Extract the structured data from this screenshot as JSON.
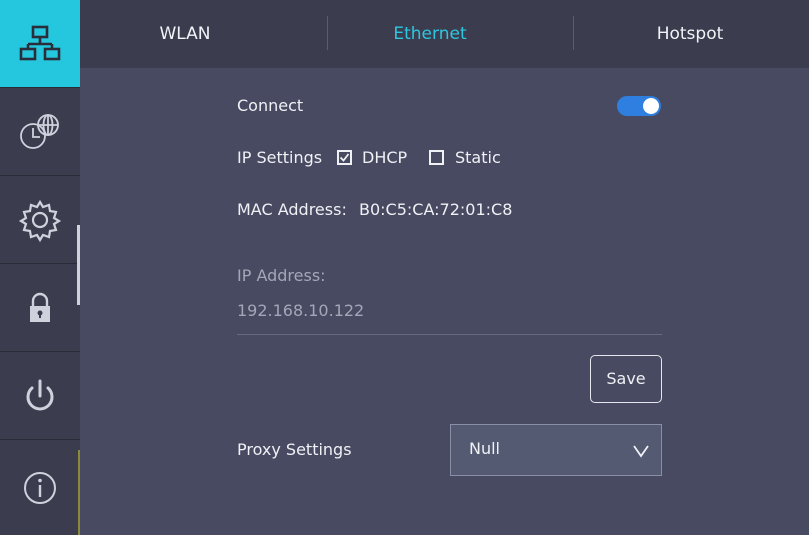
{
  "sidebar": {
    "items": [
      {
        "icon": "network-icon",
        "active": true
      },
      {
        "icon": "time-globe-icon",
        "active": false
      },
      {
        "icon": "gear-icon",
        "active": false
      },
      {
        "icon": "lock-icon",
        "active": false
      },
      {
        "icon": "power-icon",
        "active": false
      },
      {
        "icon": "info-icon",
        "active": false
      }
    ]
  },
  "tabs": [
    {
      "label": "WLAN",
      "active": false
    },
    {
      "label": "Ethernet",
      "active": true
    },
    {
      "label": "Hotspot",
      "active": false
    }
  ],
  "connect": {
    "label": "Connect",
    "enabled": true
  },
  "ip_settings": {
    "label": "IP Settings",
    "dhcp_label": "DHCP",
    "dhcp_checked": true,
    "static_label": "Static",
    "static_checked": false
  },
  "mac": {
    "label": "MAC Address:",
    "value": "B0:C5:CA:72:01:C8"
  },
  "ip_address": {
    "label": "IP Address:",
    "value": "192.168.10.122"
  },
  "save_label": "Save",
  "proxy": {
    "label": "Proxy Settings",
    "selected": "Null"
  },
  "colors": {
    "accent": "#25c7df",
    "toggle": "#2f7fe0",
    "background": "#474a61",
    "bar": "#3b3d4f"
  }
}
